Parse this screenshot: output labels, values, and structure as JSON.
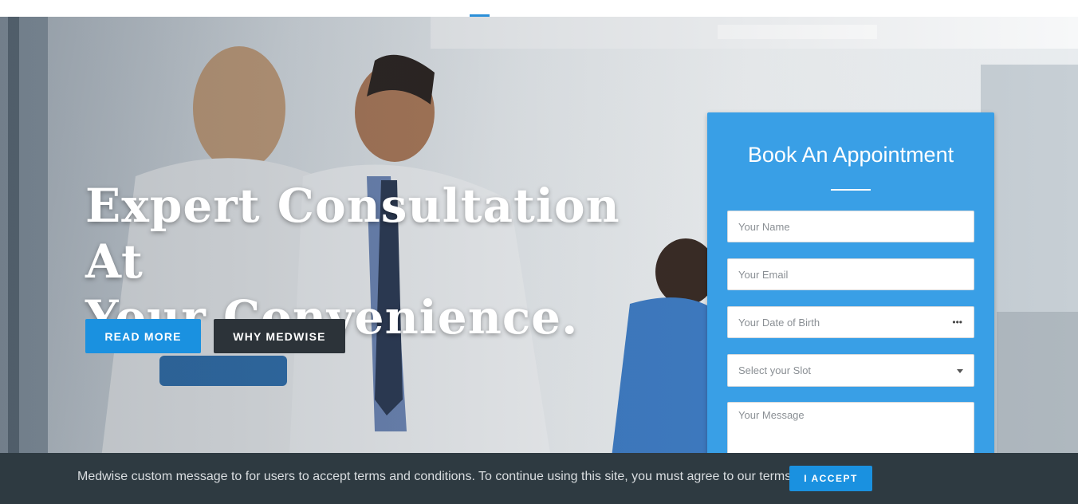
{
  "hero": {
    "headline_line1": "Expert Consultation At",
    "headline_line2": "Your Convenience.",
    "read_more_label": "READ MORE",
    "why_label": "WHY MEDWISE"
  },
  "appointment": {
    "title": "Book An Appointment",
    "name_placeholder": "Your Name",
    "email_placeholder": "Your Email",
    "dob_placeholder": "Your Date of Birth",
    "slot_placeholder": "Select your Slot",
    "message_placeholder": "Your Message"
  },
  "cookie_banner": {
    "message": "Medwise custom message to for users to accept terms and conditions. To continue using this site, you must agree to our terms.",
    "accept_label": "I ACCEPT"
  },
  "colors": {
    "accent": "#1a91e0",
    "dark": "#2c3339",
    "panel": "#399fe6",
    "banner": "#2e3a41"
  }
}
